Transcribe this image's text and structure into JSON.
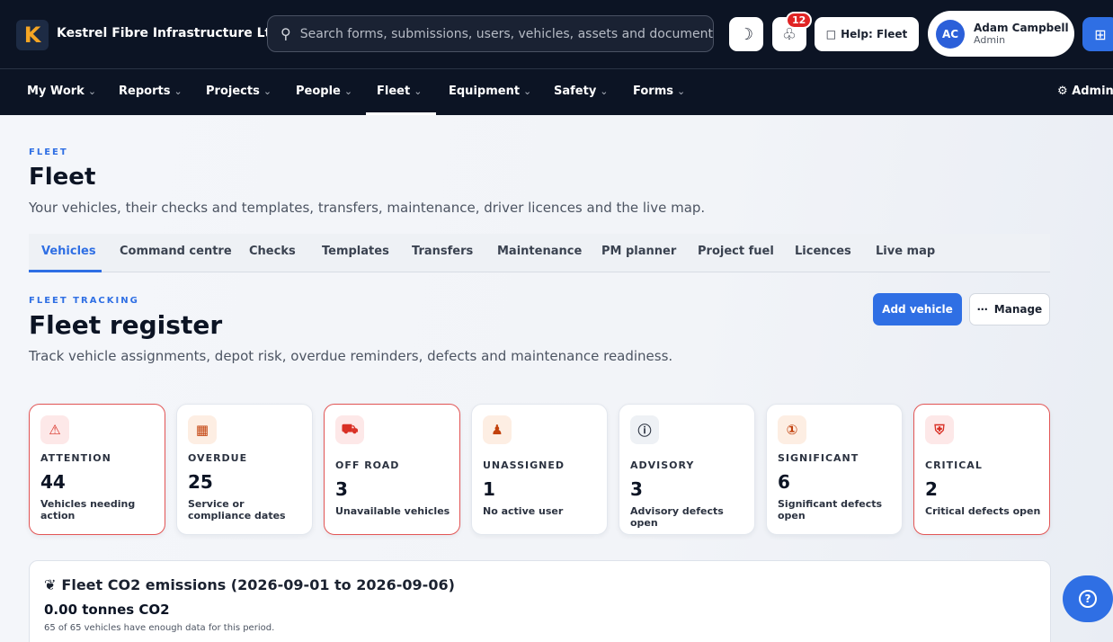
{
  "header": {
    "logo_letter": "K",
    "company": "Kestrel Fibre Infrastructure Ltd",
    "search_placeholder": "Search forms, submissions, users, vehicles, assets and documents...",
    "notification_count": "12",
    "help_label": "Help: Fleet",
    "user": {
      "initials": "AC",
      "name": "Adam Campbell",
      "role": "Admin"
    }
  },
  "nav": {
    "items": [
      "My Work",
      "Reports",
      "Projects",
      "People",
      "Fleet",
      "Equipment",
      "Safety",
      "Forms"
    ],
    "active": "Fleet",
    "admin_label": "Admin"
  },
  "page": {
    "kicker": "FLEET",
    "title": "Fleet",
    "subtitle": "Your vehicles, their checks and templates, transfers, maintenance, driver licences and the live map.",
    "tabs": [
      "Vehicles",
      "Command centre",
      "Checks",
      "Templates",
      "Transfers",
      "Maintenance",
      "PM planner",
      "Project fuel",
      "Licences",
      "Live map"
    ],
    "active_tab": "Vehicles"
  },
  "section": {
    "kicker": "FLEET TRACKING",
    "title": "Fleet register",
    "subtitle": "Track vehicle assignments, depot risk, overdue reminders, defects and maintenance readiness.",
    "add_vehicle_label": "Add vehicle",
    "manage_label": "Manage"
  },
  "cards": [
    {
      "label": "ATTENTION",
      "value": "44",
      "desc": "Vehicles needing action",
      "icon": "warning-icon",
      "alert": true,
      "color": "#d93025",
      "bg": "#fde8e8"
    },
    {
      "label": "OVERDUE",
      "value": "25",
      "desc": "Service or compliance dates",
      "icon": "calendar-icon",
      "alert": false,
      "color": "#c2410c",
      "bg": "#fdeee3"
    },
    {
      "label": "OFF ROAD",
      "value": "3",
      "desc": "Unavailable vehicles",
      "icon": "truck-icon",
      "alert": true,
      "color": "#d93025",
      "bg": "#fde8e8"
    },
    {
      "label": "UNASSIGNED",
      "value": "1",
      "desc": "No active user",
      "icon": "users-icon",
      "alert": false,
      "color": "#c2410c",
      "bg": "#fdeee3"
    },
    {
      "label": "ADVISORY",
      "value": "3",
      "desc": "Advisory defects open",
      "icon": "info-icon",
      "alert": false,
      "color": "#2b3240",
      "bg": "#eef1f5"
    },
    {
      "label": "SIGNIFICANT",
      "value": "6",
      "desc": "Significant defects open",
      "icon": "alert-circle-icon",
      "alert": false,
      "color": "#c2410c",
      "bg": "#fdeee3"
    },
    {
      "label": "CRITICAL",
      "value": "2",
      "desc": "Critical defects open",
      "icon": "shield-alert-icon",
      "alert": true,
      "color": "#d93025",
      "bg": "#fde8e8"
    }
  ],
  "emissions": {
    "title": "Fleet CO2 emissions (2026-09-01 to 2026-09-06)",
    "value": "0.00 tonnes CO2",
    "note": "65 of 65 vehicles have enough data for this period."
  }
}
